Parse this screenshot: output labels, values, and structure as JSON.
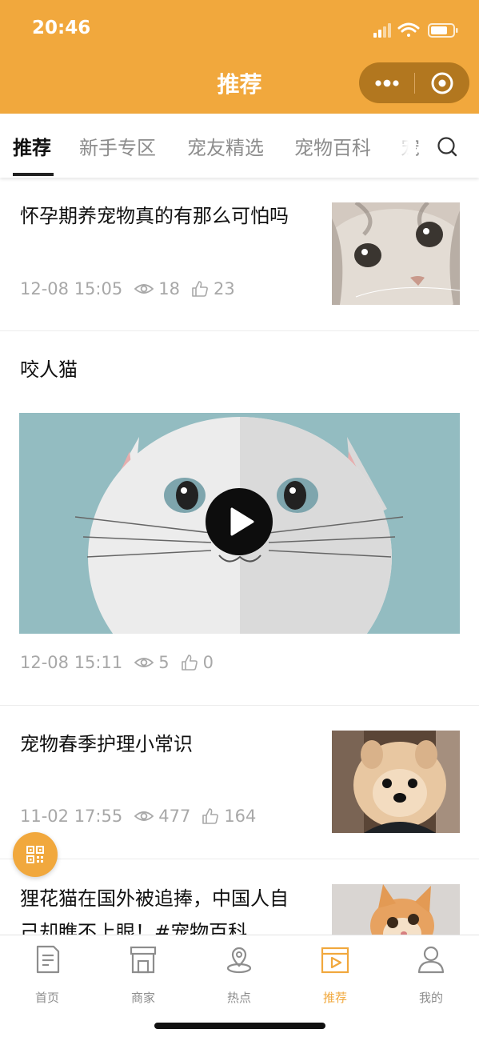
{
  "status_bar": {
    "time": "20:46"
  },
  "nav": {
    "title": "推荐"
  },
  "tabs": [
    {
      "label": "推荐"
    },
    {
      "label": "新手专区"
    },
    {
      "label": "宠友精选"
    },
    {
      "label": "宠物百科"
    },
    {
      "label": "宠"
    }
  ],
  "articles": [
    {
      "title": "怀孕期养宠物真的有那么可怕吗",
      "date": "12-08 15:05",
      "views": "18",
      "likes": "23",
      "thumb": "kitten-face"
    },
    {
      "title": "咬人猫",
      "date": "12-08 15:11",
      "views": "5",
      "likes": "0",
      "media": "video"
    },
    {
      "title": "宠物春季护理小常识",
      "date": "11-02 17:55",
      "views": "477",
      "likes": "164",
      "thumb": "pomeranian"
    },
    {
      "title_lines": [
        "狸花猫在国外被追捧，中国人自",
        "己却瞧不上眼！#宠物百科"
      ],
      "thumb": "orange-kitten"
    }
  ],
  "tabbar": [
    {
      "label": "首页",
      "icon": "document-icon"
    },
    {
      "label": "商家",
      "icon": "store-icon"
    },
    {
      "label": "热点",
      "icon": "location-icon"
    },
    {
      "label": "推荐",
      "icon": "video-icon",
      "active": true
    },
    {
      "label": "我的",
      "icon": "user-icon"
    }
  ],
  "colors": {
    "accent": "#F1A83D",
    "capsule": "#B2771F",
    "muted_text": "#a8a8a8"
  }
}
